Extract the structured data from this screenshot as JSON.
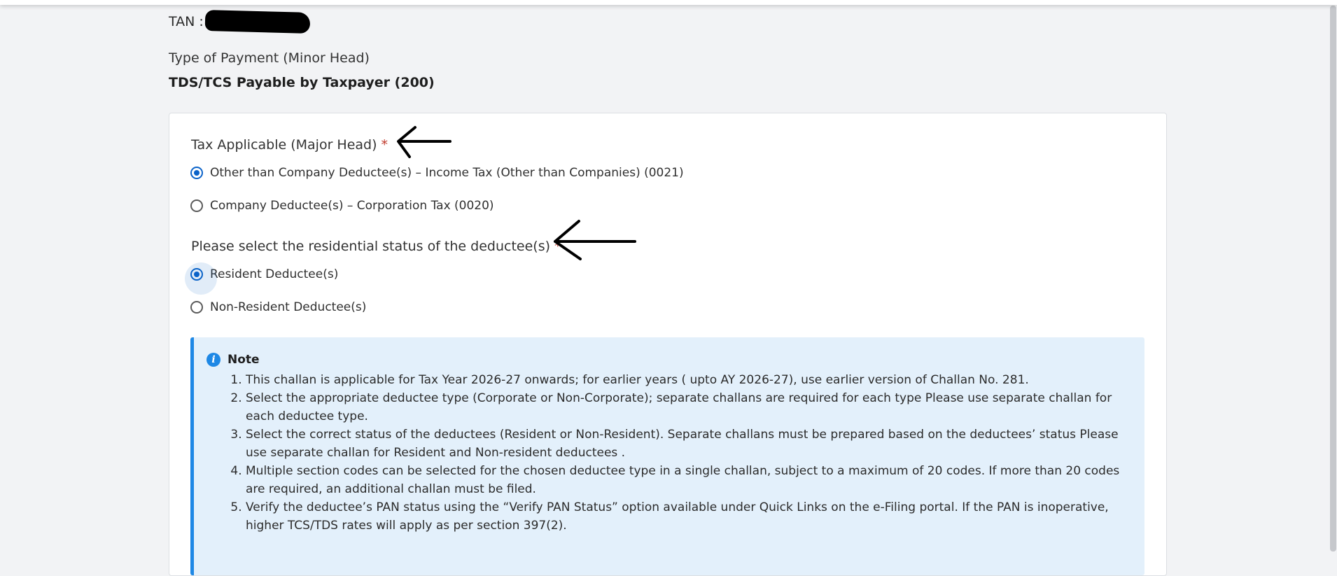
{
  "header": {
    "tan_label": "TAN :",
    "minor_head_label": "Type of Payment (Minor Head)",
    "minor_head_value": "TDS/TCS Payable by Taxpayer (200)"
  },
  "major_head": {
    "label": "Tax Applicable (Major Head)",
    "required_mark": "*",
    "options": [
      {
        "label": "Other than Company Deductee(s) – Income Tax (Other than Companies) (0021)",
        "selected": true
      },
      {
        "label": "Company Deductee(s) – Corporation Tax (0020)",
        "selected": false
      }
    ]
  },
  "residential_status": {
    "label": "Please select the residential status of the deductee(s)",
    "required_mark": "*",
    "options": [
      {
        "label": "Resident Deductee(s)",
        "selected": true
      },
      {
        "label": "Non-Resident Deductee(s)",
        "selected": false
      }
    ]
  },
  "note": {
    "icon": "info-icon",
    "icon_glyph": "i",
    "title": "Note",
    "items": [
      "This challan is applicable for Tax Year 2026-27 onwards; for earlier years ( upto AY 2026-27), use earlier version of Challan No. 281.",
      "Select the appropriate deductee type (Corporate or Non-Corporate); separate challans are required for each type Please use separate challan for each deductee type.",
      "Select the correct status of the deductees (Resident or Non-Resident). Separate challans must be prepared based on the deductees’ status Please use separate challan for Resident and Non-resident deductees .",
      "Multiple section codes can be selected for the chosen deductee type in a single challan, subject to a maximum of 20 codes. If more than 20 codes are required, an additional challan must be filed.",
      "Verify the deductee’s PAN status using the “Verify PAN Status” option available under Quick Links on the e-Filing portal. If the PAN is inoperative, higher TCS/TDS rates will apply as per section 397(2)."
    ]
  },
  "colors": {
    "accent": "#0b63c9",
    "note_background": "#e3f0fb",
    "note_border": "#1e88e5",
    "required": "#c0392b"
  }
}
